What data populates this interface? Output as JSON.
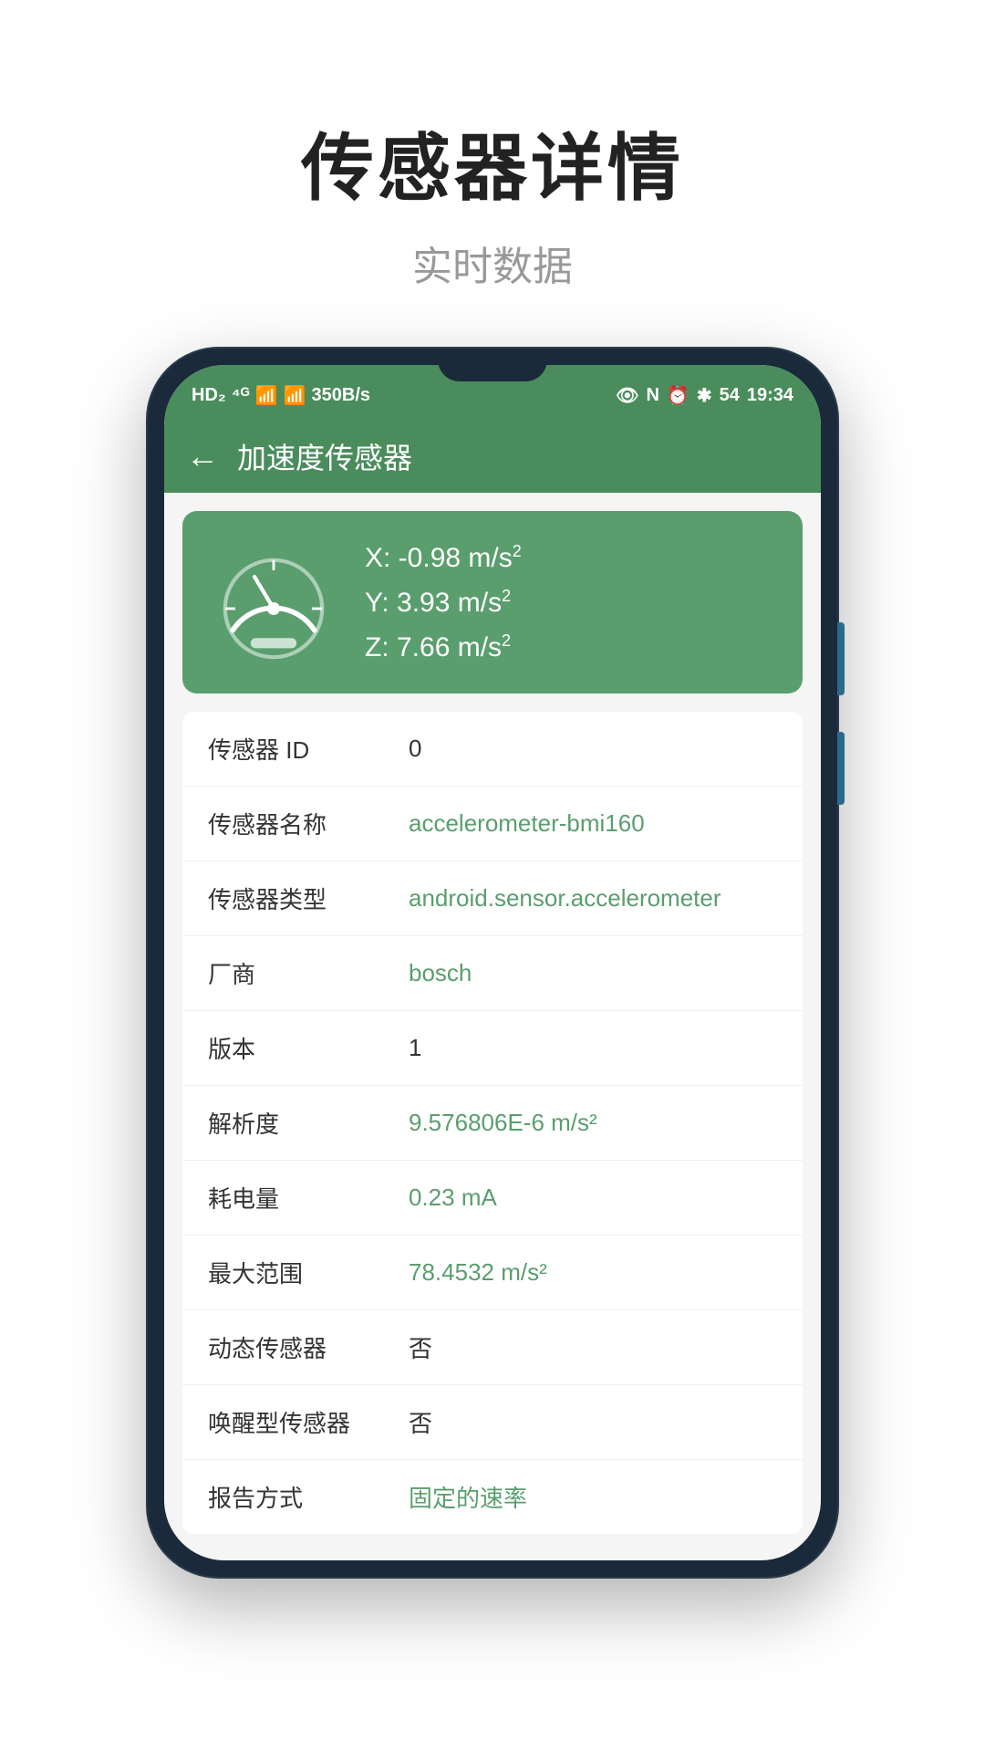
{
  "header": {
    "title": "传感器详情",
    "subtitle": "实时数据"
  },
  "status_bar": {
    "left": "HD 4G 4G 350B/s",
    "time": "19:34",
    "battery": "54"
  },
  "toolbar": {
    "back_label": "←",
    "title": "加速度传感器"
  },
  "sensor_card": {
    "x_label": "X: -0.98 m/s",
    "y_label": "Y: 3.93 m/s",
    "z_label": "Z: 7.66 m/s"
  },
  "info_rows": [
    {
      "label": "传感器 ID",
      "value": "0",
      "green": false
    },
    {
      "label": "传感器名称",
      "value": "accelerometer-bmi160",
      "green": true
    },
    {
      "label": "传感器类型",
      "value": "android.sensor.accelerometer",
      "green": true
    },
    {
      "label": "厂商",
      "value": "bosch",
      "green": true
    },
    {
      "label": "版本",
      "value": "1",
      "green": false
    },
    {
      "label": "解析度",
      "value": "9.576806E-6 m/s²",
      "green": true
    },
    {
      "label": "耗电量",
      "value": "0.23  mA",
      "green": true
    },
    {
      "label": "最大范围",
      "value": "78.4532 m/s²",
      "green": true
    },
    {
      "label": "动态传感器",
      "value": "否",
      "green": false
    },
    {
      "label": "唤醒型传感器",
      "value": "否",
      "green": false
    },
    {
      "label": "报告方式",
      "value": "固定的速率",
      "green": true
    }
  ]
}
